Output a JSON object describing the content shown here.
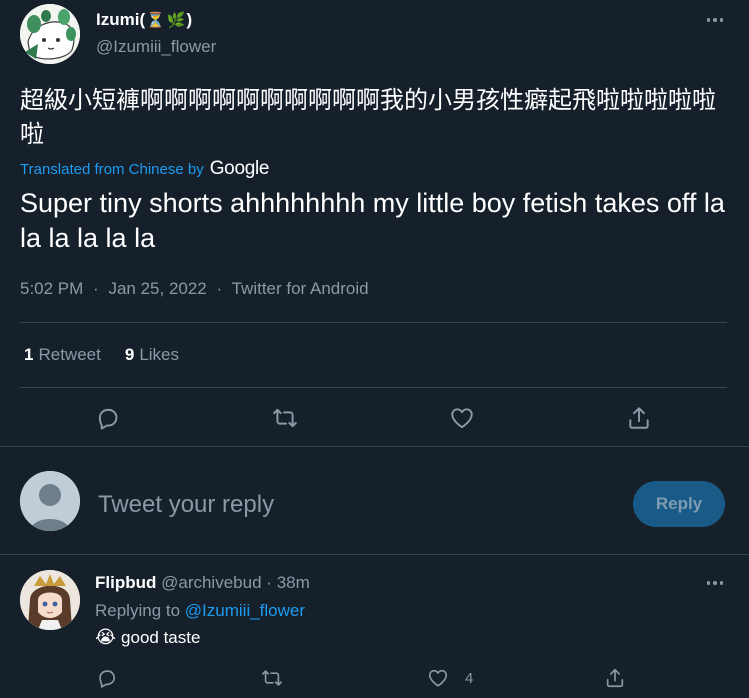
{
  "main_tweet": {
    "author": {
      "name": "Izumi(",
      "name_emojis": [
        "⏳",
        "🌿"
      ],
      "name_suffix": ")",
      "handle": "@Izumiii_flower",
      "avatar_icon": "avatar-illustration"
    },
    "more_icon": "more-dots-icon",
    "original_text": "超級小短褲啊啊啊啊啊啊啊啊啊啊我的小男孩性癖起飛啦啦啦啦啦啦",
    "translated_from": "Translated from Chinese by",
    "translator": "Google",
    "translated_text": "Super tiny shorts ahhhhhhhh my little boy fetish takes off la la la la la la",
    "time": "5:02 PM",
    "date": "Jan 25, 2022",
    "client": "Twitter for Android",
    "separator": "·",
    "stats": {
      "retweets_count": "1",
      "retweets_label": "Retweet",
      "likes_count": "9",
      "likes_label": "Likes"
    },
    "actions": [
      "reply-icon",
      "retweet-icon",
      "like-icon",
      "share-icon"
    ]
  },
  "composer": {
    "placeholder": "Tweet your reply",
    "button_label": "Reply",
    "avatar_icon": "default-avatar-icon"
  },
  "reply_tweet": {
    "name": "Flipbud",
    "handle": "@archivebud",
    "separator": "·",
    "time": "38m",
    "replying_to_label": "Replying to",
    "replying_to_handle": "@Izumiii_flower",
    "emoji": "😭",
    "text": "good taste",
    "like_count": "4",
    "actions": [
      "reply-icon",
      "retweet-icon",
      "like-icon",
      "share-icon"
    ]
  },
  "colors": {
    "background": "#15202b",
    "text": "#ffffff",
    "secondary_text": "#8b98a5",
    "link": "#1d9bf0",
    "divider": "#38444d",
    "reply_button_bg": "#1a5a86"
  }
}
